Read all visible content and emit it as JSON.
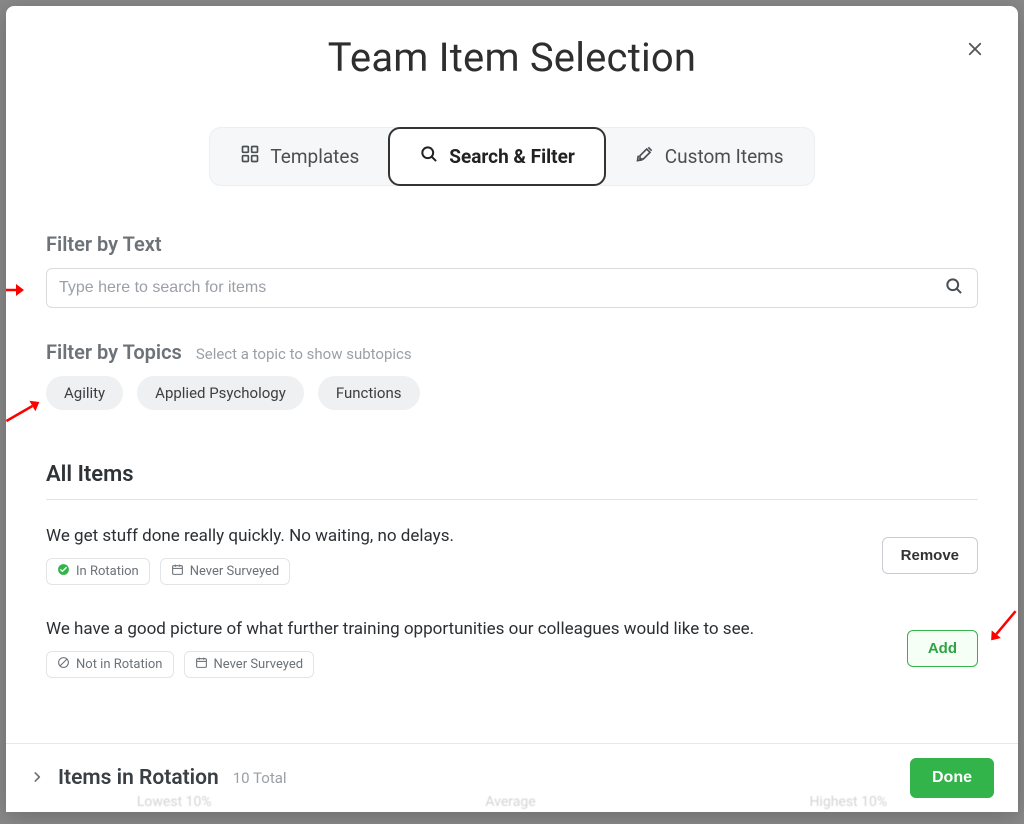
{
  "header": {
    "title": "Team Item Selection"
  },
  "tabs": {
    "templates": "Templates",
    "search": "Search & Filter",
    "custom": "Custom Items"
  },
  "filterText": {
    "label": "Filter by Text",
    "placeholder": "Type here to search for items"
  },
  "filterTopics": {
    "label": "Filter by Topics",
    "sub": "Select a topic to show subtopics",
    "chips": [
      "Agility",
      "Applied Psychology",
      "Functions"
    ]
  },
  "allItems": {
    "heading": "All Items",
    "items": [
      {
        "text": "We get stuff done really quickly. No waiting, no delays.",
        "rotation_label": "In Rotation",
        "in_rotation": true,
        "survey_label": "Never Surveyed",
        "action_label": "Remove",
        "action": "remove"
      },
      {
        "text": "We have a good picture of what further training opportunities our colleagues would like to see.",
        "rotation_label": "Not in Rotation",
        "in_rotation": false,
        "survey_label": "Never Surveyed",
        "action_label": "Add",
        "action": "add"
      }
    ]
  },
  "footer": {
    "rotation_label": "Items in Rotation",
    "count_label": "10 Total",
    "done_label": "Done"
  },
  "bg_hints": [
    "Lowest 10%",
    "Average",
    "Highest 10%"
  ]
}
